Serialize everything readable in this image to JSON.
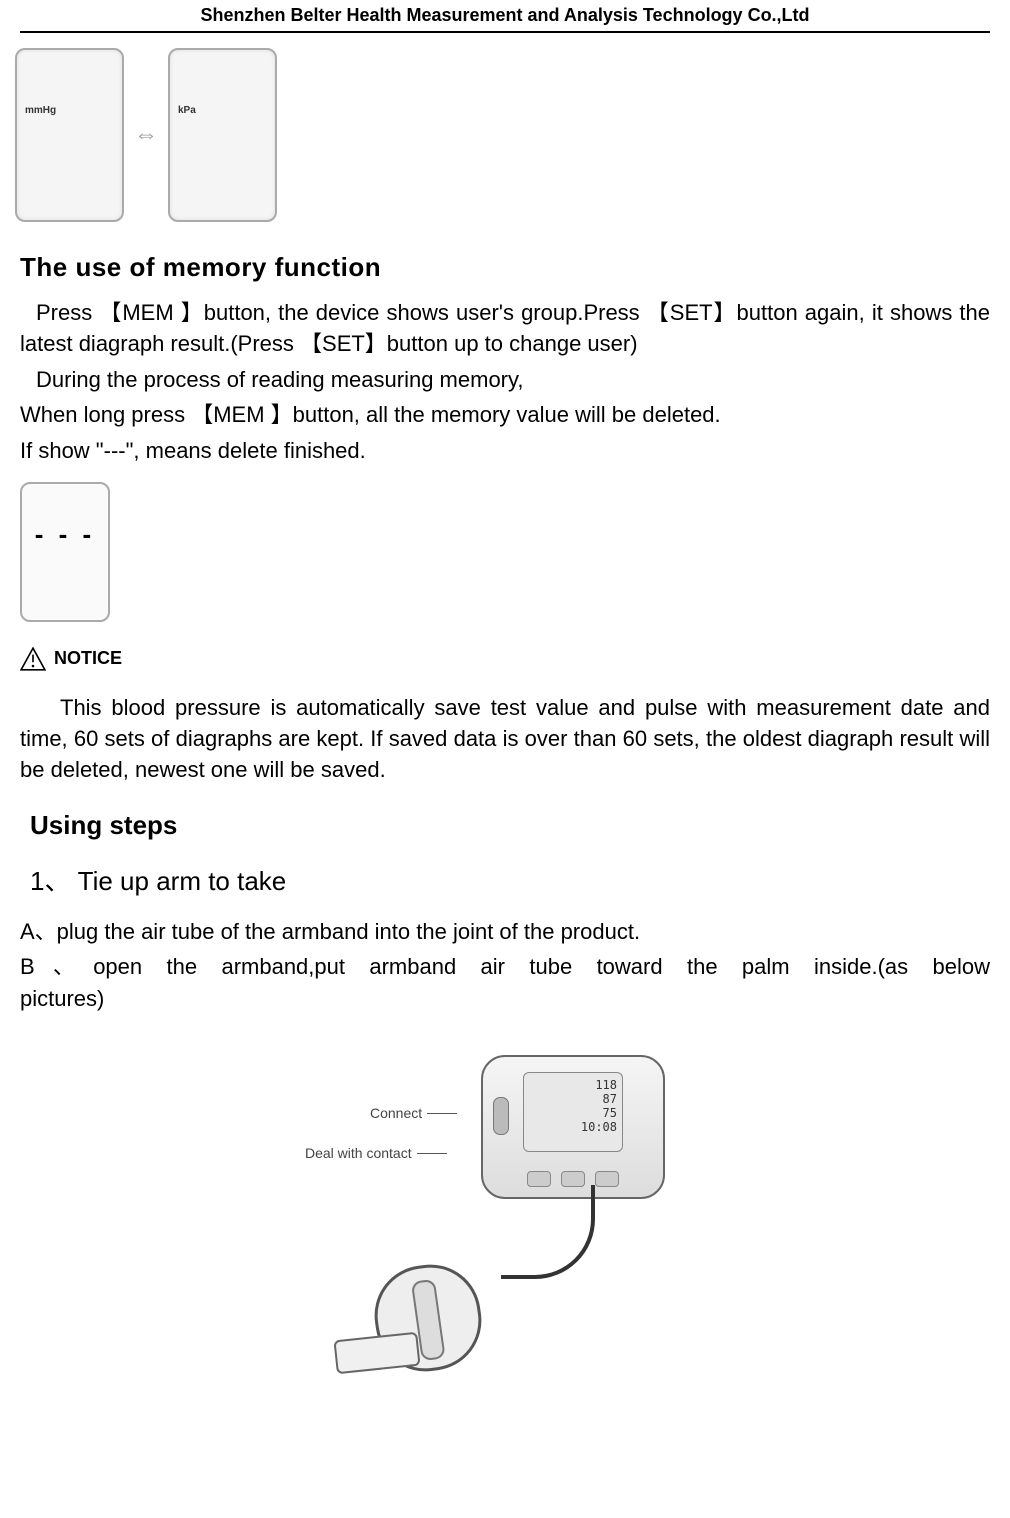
{
  "header": {
    "company": "Shenzhen Belter Health Measurement and Analysis Technology Co.,Ltd"
  },
  "figTop": {
    "leftLabel": "mmHg",
    "rightLabel": "kPa"
  },
  "section_memory": {
    "title": "The use of memory function",
    "p1": "Press 【MEM 】button, the device shows user's group.Press 【SET】button again, it shows the latest diagraph result.(Press 【SET】button up to change user)",
    "p2": "During the process of reading measuring memory,",
    "p3": "When long press 【MEM 】button, all the memory value will be deleted.",
    "p4": "If show \"---\", means delete finished.",
    "dashDisplay": "- - -"
  },
  "notice": {
    "label": "NOTICE",
    "body": "This blood pressure is automatically save test value and pulse with measurement date and time, 60 sets of diagraphs are kept. If saved data is over than 60 sets, the oldest diagraph result will be deleted, newest one will be saved."
  },
  "section_steps": {
    "title": "Using steps",
    "step1_title": "1、   Tie up arm to take",
    "step1_a": "A、plug the air tube of the armband into the joint of the product.",
    "step1_b_line1": "B、open the armband,put armband air tube toward the palm inside.(as below",
    "step1_b_line2": "pictures)"
  },
  "figBottom": {
    "connectLabel": "Connect",
    "dealLabel": "Deal with contact",
    "lcdTop": "118",
    "lcdMid": "87",
    "lcdBot": "75",
    "lcdTime": "10:08"
  }
}
